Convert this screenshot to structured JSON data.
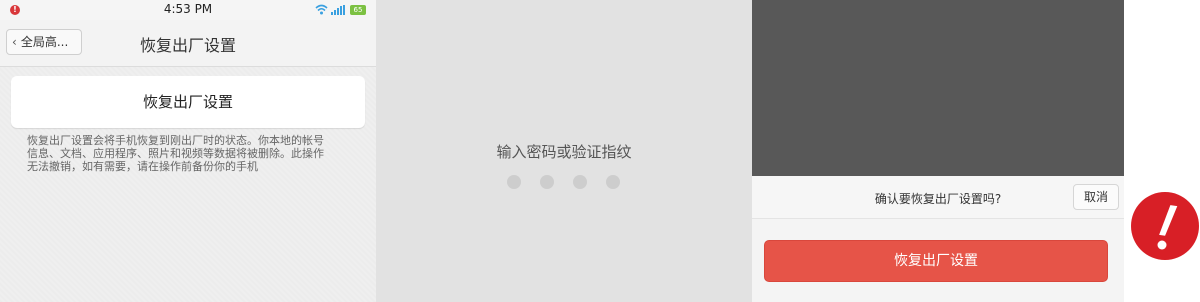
{
  "statusbar": {
    "time": "4:53 PM",
    "battery": "65"
  },
  "settings_screen": {
    "back_label": "全局高...",
    "title": "恢复出厂设置",
    "reset_item_label": "恢复出厂设置",
    "description_lines": [
      "恢复出厂设置会将手机恢复到刚出厂时的状态。你本地的帐号",
      "信息、文档、应用程序、照片和视频等数据将被删除。此操作",
      "无法撤销，如有需要，请在操作前备份你的手机"
    ]
  },
  "password_screen": {
    "prompt": "输入密码或验证指纹",
    "digits_entered": 0,
    "digits_total": 4
  },
  "confirm_sheet": {
    "question": "确认要恢复出厂设置吗?",
    "cancel_label": "取消",
    "confirm_label": "恢复出厂设置"
  },
  "icons": [
    "back-chevron-icon",
    "wifi-icon",
    "signal-icon",
    "battery-icon",
    "alert-exclamation-icon"
  ],
  "colors": {
    "danger": "#e65448",
    "alert": "#d81f26",
    "overlay": "#585858"
  }
}
